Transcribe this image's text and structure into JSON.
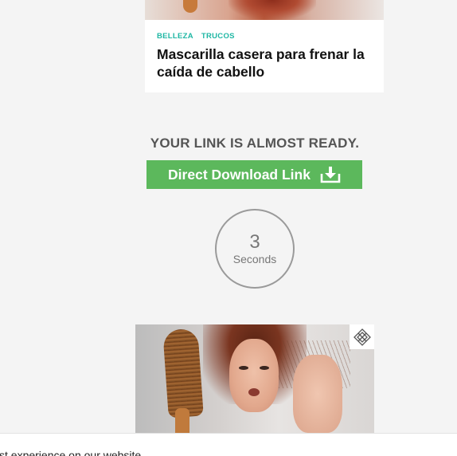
{
  "article_card": {
    "tags": [
      "BELLEZA",
      "TRUCOS"
    ],
    "title": "Mascarilla casera para frenar la caída de cabello"
  },
  "download": {
    "heading": "YOUR LINK IS ALMOST READY.",
    "button_label": "Direct Download Link",
    "button_icon": "download-icon",
    "button_color": "#5cb85c"
  },
  "countdown": {
    "value": "3",
    "unit": "Seconds"
  },
  "ad": {
    "badge_icon": "ad-choices-icon"
  },
  "cookie_bar": {
    "text": "st experience on our website."
  },
  "colors": {
    "page_background": "#f4f4f4",
    "tag_color": "#1fb7a4",
    "heading_color": "#555555"
  }
}
